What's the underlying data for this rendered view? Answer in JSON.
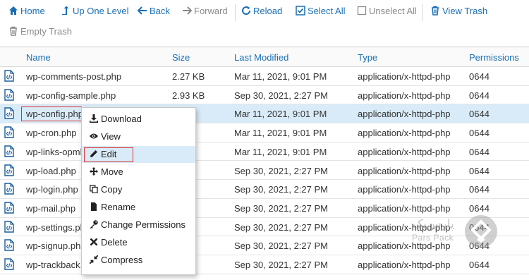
{
  "toolbar": {
    "home": "Home",
    "up": "Up One Level",
    "back": "Back",
    "forward": "Forward",
    "reload": "Reload",
    "select_all": "Select All",
    "unselect_all": "Unselect All",
    "view_trash": "View Trash",
    "empty_trash": "Empty Trash"
  },
  "table": {
    "headers": {
      "name": "Name",
      "size": "Size",
      "modified": "Last Modified",
      "type": "Type",
      "permissions": "Permissions"
    },
    "rows": [
      {
        "name": "wp-comments-post.php",
        "size": "2.27 KB",
        "modified": "Mar 11, 2021, 9:01 PM",
        "type": "application/x-httpd-php",
        "perm": "0644"
      },
      {
        "name": "wp-config-sample.php",
        "size": "2.93 KB",
        "modified": "Sep 30, 2021, 2:27 PM",
        "type": "application/x-httpd-php",
        "perm": "0644"
      },
      {
        "name": "wp-config.php",
        "size": "",
        "modified": "Mar 11, 2021, 9:01 PM",
        "type": "application/x-httpd-php",
        "perm": "0644"
      },
      {
        "name": "wp-cron.php",
        "size": "",
        "modified": "Mar 11, 2021, 9:01 PM",
        "type": "application/x-httpd-php",
        "perm": "0644"
      },
      {
        "name": "wp-links-opml.",
        "size": "",
        "modified": "Mar 11, 2021, 9:01 PM",
        "type": "application/x-httpd-php",
        "perm": "0644"
      },
      {
        "name": "wp-load.php",
        "size": "",
        "modified": "Sep 30, 2021, 2:27 PM",
        "type": "application/x-httpd-php",
        "perm": "0644"
      },
      {
        "name": "wp-login.php",
        "size": "",
        "modified": "Sep 30, 2021, 2:27 PM",
        "type": "application/x-httpd-php",
        "perm": "0644"
      },
      {
        "name": "wp-mail.php",
        "size": "",
        "modified": "Sep 30, 2021, 2:27 PM",
        "type": "application/x-httpd-php",
        "perm": "0644"
      },
      {
        "name": "wp-settings.ph",
        "size": "KB",
        "modified": "Sep 30, 2021, 2:27 PM",
        "type": "application/x-httpd-php",
        "perm": "0644"
      },
      {
        "name": "wp-signup.php",
        "size": "KB",
        "modified": "Sep 30, 2021, 2:27 PM",
        "type": "application/x-httpd-php",
        "perm": "0644"
      },
      {
        "name": "wp-trackback.",
        "size": "KB",
        "modified": "Sep 30, 2021, 2:27 PM",
        "type": "application/x-httpd-php",
        "perm": "0644"
      }
    ]
  },
  "context_menu": {
    "download": "Download",
    "view": "View",
    "edit": "Edit",
    "move": "Move",
    "copy": "Copy",
    "rename": "Rename",
    "change_permissions": "Change Permissions",
    "delete": "Delete",
    "compress": "Compress"
  },
  "watermark": {
    "line1": "پارس‌پک",
    "line2": "Pars Pack"
  },
  "colors": {
    "link": "#1a6fb5",
    "selected_row": "#d9ebf8",
    "highlight_border": "#d9302f"
  }
}
